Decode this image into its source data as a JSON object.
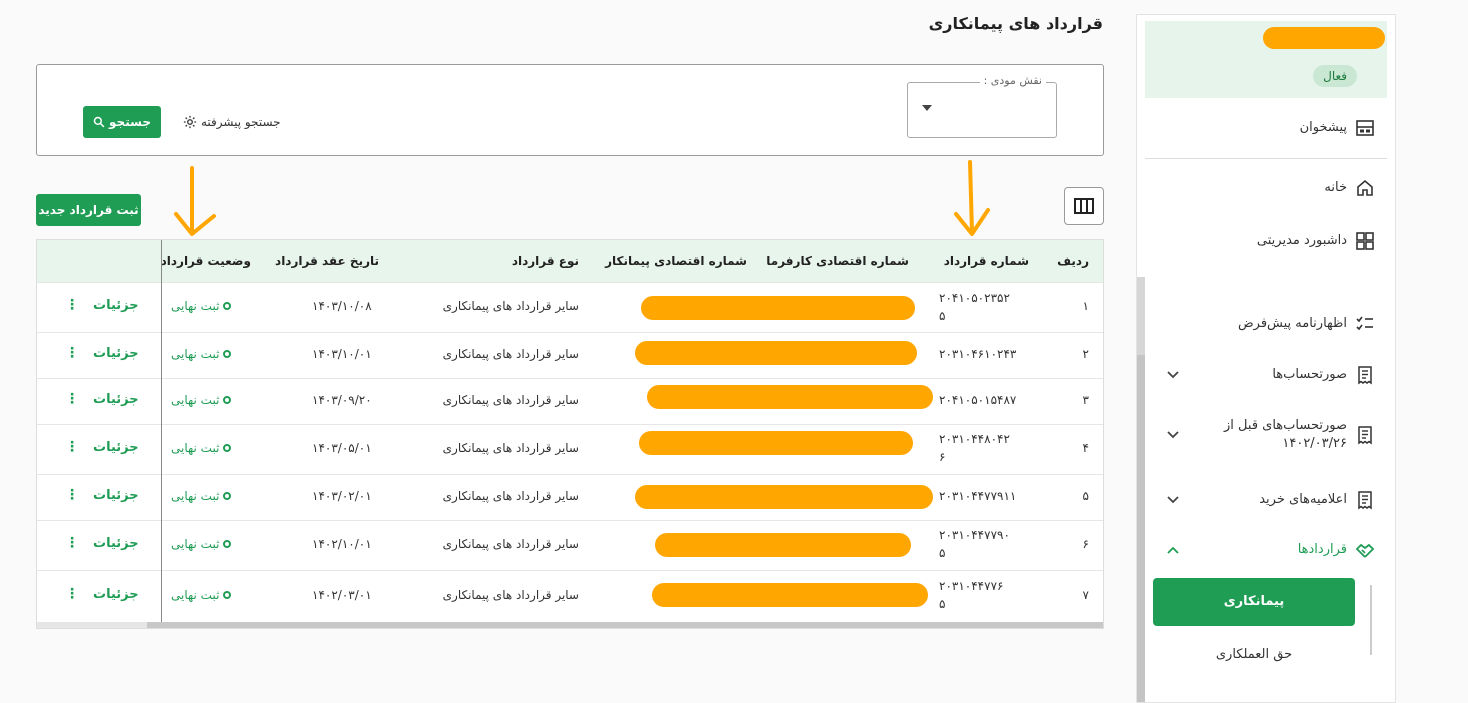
{
  "page": {
    "title": "قرارداد های پیمانکاری"
  },
  "sidebar": {
    "status": "فعال",
    "items": [
      {
        "label": "پیشخوان",
        "icon": "inbox-icon"
      },
      {
        "label": "خانه",
        "icon": "home-icon"
      },
      {
        "label": "داشبورد مدیریتی",
        "icon": "dashboard-icon"
      },
      {
        "label": "اظهارنامه پیش‌فرض",
        "icon": "checklist-icon"
      },
      {
        "label": "صورتحساب‌ها",
        "icon": "receipt-icon"
      },
      {
        "label": "صورتحساب‌های قبل از",
        "label2": "۱۴۰۲/۰۳/۲۶",
        "icon": "receipt-icon"
      },
      {
        "label": "اعلامیه‌های خرید",
        "icon": "receipt-icon"
      },
      {
        "label": "قراردادها",
        "icon": "handshake-icon"
      }
    ],
    "sub_items": [
      {
        "label": "پیمانکاری",
        "active": true
      },
      {
        "label": "حق العملکاری",
        "active": false
      }
    ]
  },
  "search": {
    "role_label": "نقش مودی :",
    "advanced_label": "جستجو پیشرفته",
    "search_button": "جستجو"
  },
  "toolbar": {
    "new_contract": "ثبت قرارداد جدید"
  },
  "table": {
    "headers": {
      "row": "ردیف",
      "contract_no": "شماره قرارداد",
      "employer_code": "شماره اقتصادی کارفرما",
      "contractor_code": "شماره اقتصادی پیمانکار",
      "type": "نوع قرارداد",
      "date": "تاریخ عقد قرارداد",
      "status": "وضعیت قرارداد"
    },
    "rows": [
      {
        "idx": "۱",
        "no1": "۲۰۴۱۰۵۰۲۳۵۲",
        "no2": "۵",
        "type": "سایر قرارداد های پیمانکاری",
        "date": "۱۴۰۳/۱۰/۰۸",
        "status": "ثبت نهایی",
        "details": "جزئیات",
        "more": "⋮"
      },
      {
        "idx": "۲",
        "no1": "۲۰۳۱۰۴۶۱۰۲۴۳",
        "no2": "",
        "type": "سایر قرارداد های پیمانکاری",
        "date": "۱۴۰۳/۱۰/۰۱",
        "status": "ثبت نهایی",
        "details": "جزئیات",
        "more": "⋮"
      },
      {
        "idx": "۳",
        "no1": "۲۰۴۱۰۵۰۱۵۴۸۷",
        "no2": "",
        "type": "سایر قرارداد های پیمانکاری",
        "date": "۱۴۰۳/۰۹/۲۰",
        "status": "ثبت نهایی",
        "details": "جزئیات",
        "more": "⋮"
      },
      {
        "idx": "۴",
        "no1": "۲۰۳۱۰۴۴۸۰۴۲",
        "no2": "۶",
        "type": "سایر قرارداد های پیمانکاری",
        "date": "۱۴۰۳/۰۵/۰۱",
        "status": "ثبت نهایی",
        "details": "جزئیات",
        "more": "⋮"
      },
      {
        "idx": "۵",
        "no1": "۲۰۳۱۰۴۴۷۷۹۱۱",
        "no2": "",
        "type": "سایر قرارداد های پیمانکاری",
        "date": "۱۴۰۳/۰۲/۰۱",
        "status": "ثبت نهایی",
        "details": "جزئیات",
        "more": "⋮"
      },
      {
        "idx": "۶",
        "no1": "۲۰۳۱۰۴۴۷۷۹۰",
        "no2": "۵",
        "type": "سایر قرارداد های پیمانکاری",
        "date": "۱۴۰۲/۱۰/۰۱",
        "status": "ثبت نهایی",
        "details": "جزئیات",
        "more": "⋮"
      },
      {
        "idx": "۷",
        "no1": "۲۰۳۱۰۴۴۷۷۶",
        "no2": "۵",
        "type": "سایر قرارداد های پیمانکاری",
        "date": "۱۴۰۲/۰۳/۰۱",
        "status": "ثبت نهایی",
        "details": "جزئیات",
        "more": "⋮"
      }
    ]
  },
  "colors": {
    "primary": "#1f9d55",
    "redaction": "#ffa600",
    "header_bg": "#e8f5ed"
  }
}
